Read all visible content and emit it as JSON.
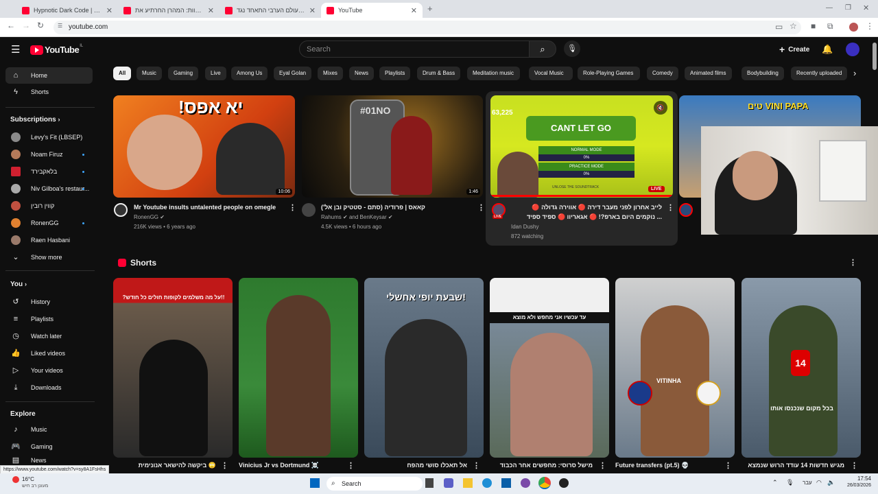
{
  "browser": {
    "tabs": [
      {
        "label": "Hypnotic Dark Code | Futuristic",
        "active": false
      },
      {
        "label": "ענש מוות: המהרן החרתיע את",
        "active": false
      },
      {
        "label": "למה העולם הערבי התאחד נגד",
        "active": false
      },
      {
        "label": "YouTube",
        "active": true
      }
    ],
    "url": "youtube.com",
    "status_url": "https://www.youtube.com/watch?v=sy8A1FsHhs"
  },
  "header": {
    "logo_text": "YouTube",
    "logo_region": "IL",
    "search_placeholder": "Search",
    "create_label": "Create"
  },
  "sidebar": {
    "main": [
      {
        "label": "Home",
        "icon": "home-icon",
        "active": true
      },
      {
        "label": "Shorts",
        "icon": "shorts-icon",
        "active": false
      }
    ],
    "subscriptions_title": "Subscriptions",
    "subscriptions": [
      {
        "label": "Levy's Fit (LBSEP)",
        "color": "#8a8a8a",
        "dot": false
      },
      {
        "label": "Noam Firuz",
        "color": "#b57a5a",
        "dot": true
      },
      {
        "label": "בלאקבירד",
        "color": "#d02030",
        "dot": true
      },
      {
        "label": "Niv Gilboa's restaur...",
        "color": "#aaaaaa",
        "dot": true
      },
      {
        "label": "קווין רובין",
        "color": "#c05040",
        "dot": false
      },
      {
        "label": "RonenGG",
        "color": "#e08030",
        "dot": true
      },
      {
        "label": "Raen Hasbani",
        "color": "#9a7a6a",
        "dot": false
      }
    ],
    "show_more": "Show more",
    "you_title": "You",
    "you": [
      {
        "label": "History",
        "icon": "history-icon"
      },
      {
        "label": "Playlists",
        "icon": "playlists-icon"
      },
      {
        "label": "Watch later",
        "icon": "watch-later-icon"
      },
      {
        "label": "Liked videos",
        "icon": "like-icon"
      },
      {
        "label": "Your videos",
        "icon": "your-videos-icon"
      },
      {
        "label": "Downloads",
        "icon": "download-icon"
      }
    ],
    "explore_title": "Explore",
    "explore": [
      {
        "label": "Music",
        "icon": "music-icon"
      },
      {
        "label": "Gaming",
        "icon": "gaming-icon"
      },
      {
        "label": "News",
        "icon": "news-icon"
      }
    ]
  },
  "chips": [
    "All",
    "Music",
    "Gaming",
    "Live",
    "Among Us",
    "Eyal Golan",
    "Mixes",
    "News",
    "Playlists",
    "Drum & Bass",
    "Meditation music",
    "Vocal Music",
    "Role-Playing Games",
    "Comedy",
    "Animated films",
    "Bodybuilding",
    "Recently uploaded"
  ],
  "videos": [
    {
      "title": "Mr Youtube insults untalented people on omegle",
      "channel": "RonenGG",
      "meta": "216K views • 6 years ago",
      "duration": "10:06",
      "thumb_text": "!יא אפס"
    },
    {
      "title": "קאאס | פרודיה (סתם - סטטיק ובן אל')",
      "channel": "Rahums",
      "channel2": "and BenKeysar",
      "meta": "4.5K views • 6 hours ago",
      "duration": "1:46",
      "thumb_text": "#01NO"
    },
    {
      "title": "לייב אחרון לפני מעבר דירה 🔴 אווירה גדולה 🔴",
      "title2": "... נוקמים היום בארפ?! 🔴 אגאריוו 🔴 ספיד ספיד",
      "channel": "Idan Dushy",
      "meta": "872 watching",
      "live": "LIVE",
      "thumb_text": "CANT LET GO",
      "score": "63,225",
      "mode1": "NORMAL MODE",
      "mode2": "PRACTICE MODE",
      "pct": "0%",
      "sound": "UNLOSE THE SOUNDTRACK"
    },
    {
      "title": "",
      "thumb_text": "טים VINI PAPA"
    }
  ],
  "shorts": {
    "title": "Shorts",
    "items": [
      {
        "title": "🙄 ביקשה להישאר אנונימית",
        "thumb_text": "!!על מה משלמים לקופות חולים כל חודש?"
      },
      {
        "title": "Vinicius Jr vs Dortmund ☠️",
        "thumb_text": ""
      },
      {
        "title": "אל תאכלו סושי מהפח",
        "thumb_text": "!שבעת יופי אחשלי"
      },
      {
        "title": "מישל סרוסי: מחפשים אחר הכבוד",
        "thumb_text": "עד עכשיו אני מחפש ולא מוצא"
      },
      {
        "title": "Future transfers (pt.5) 💀",
        "thumb_text": "VITINHA"
      },
      {
        "title": "מגיש חדשות 14 עודד הרוש שנמצא",
        "thumb_text": "בכל מקום שנכנסו אותו"
      }
    ]
  },
  "taskbar": {
    "weather": "16°C",
    "weather_sub": "מעונן רב חיש",
    "search": "Search",
    "time": "17:54",
    "date": "26/03/2026",
    "lang": "עבר"
  }
}
